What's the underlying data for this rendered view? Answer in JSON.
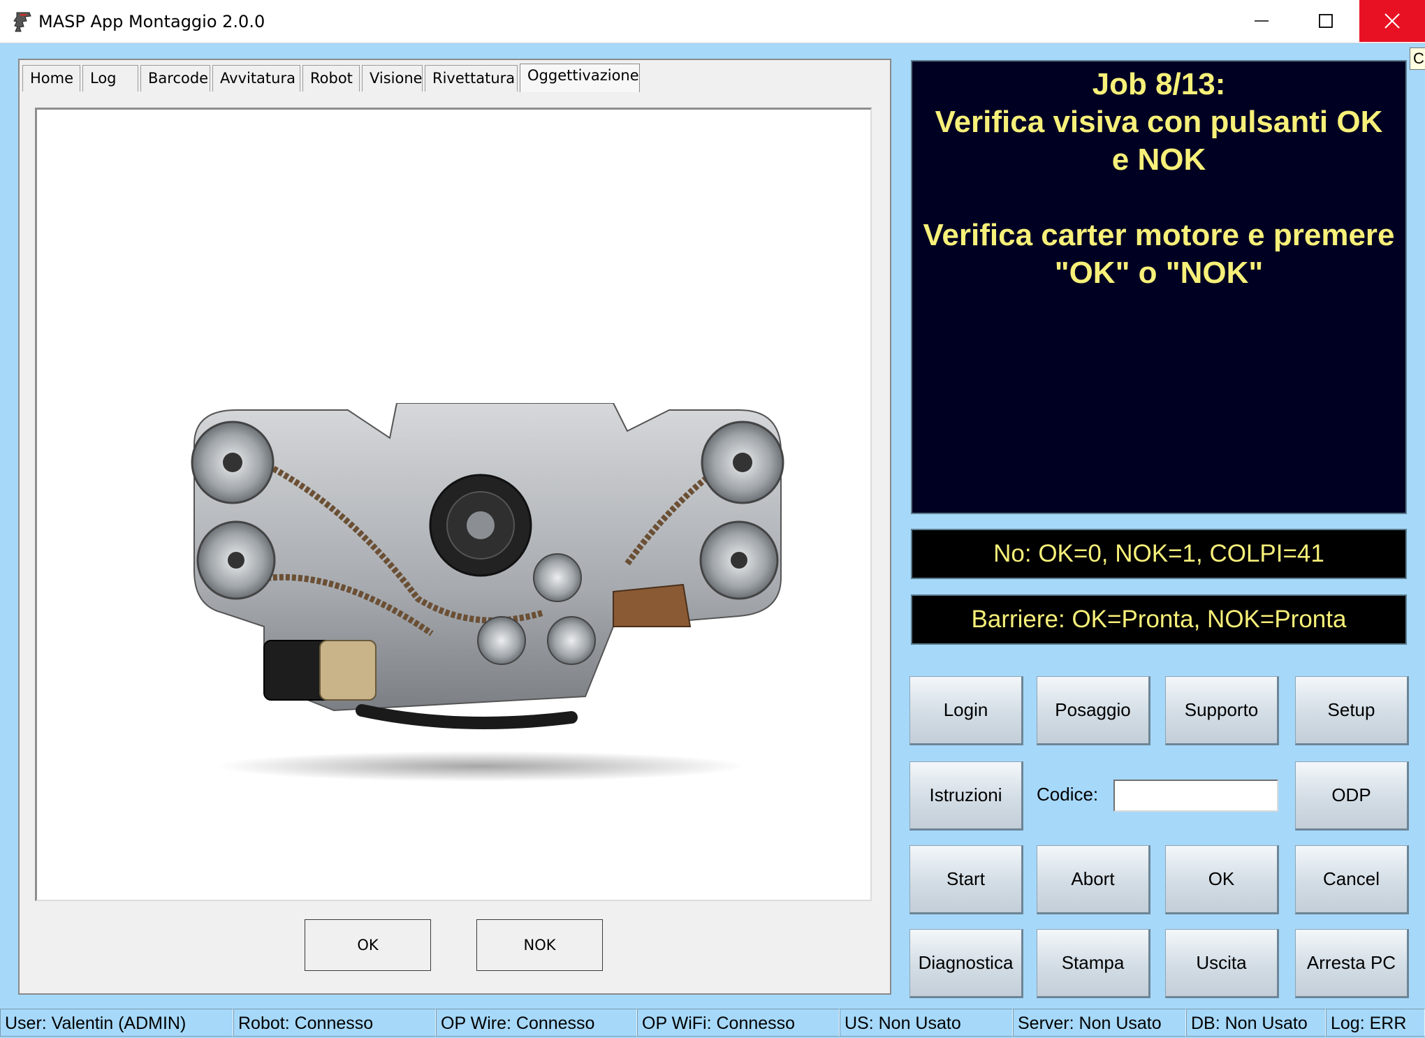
{
  "window": {
    "title": "MASP App Montaggio 2.0.0"
  },
  "tabs": [
    "Home",
    "Log",
    "Barcode",
    "Avvitatura",
    "Robot",
    "Visione",
    "Rivettatura",
    "Oggettivazione"
  ],
  "active_tab": "Oggettivazione",
  "panel": {
    "ok_label": "OK",
    "nok_label": "NOK"
  },
  "message": {
    "line1": "Job 8/13:",
    "line2": "Verifica visiva con pulsanti OK",
    "line3": "e NOK",
    "line4": "Verifica carter motore e premere",
    "line5": "\"OK\" o \"NOK\""
  },
  "counter": "No: OK=0, NOK=1, COLPI=41",
  "barrier": "Barriere: OK=Pronta, NOK=Pronta",
  "buttons": {
    "login": "Login",
    "posaggio": "Posaggio",
    "supporto": "Supporto",
    "setup": "Setup",
    "istruzioni": "Istruzioni",
    "odp": "ODP",
    "start": "Start",
    "abort": "Abort",
    "ok": "OK",
    "cancel": "Cancel",
    "diagnostica": "Diagnostica",
    "stampa": "Stampa",
    "uscita": "Uscita",
    "arresta": "Arresta PC"
  },
  "codice": {
    "label": "Codice:",
    "value": ""
  },
  "tooltip": "Cl",
  "status_bar": {
    "user": "User: Valentin (ADMIN)",
    "robot": "Robot: Connesso",
    "op_wire": "OP Wire: Connesso",
    "op_wifi": "OP WiFi: Connesso",
    "us": "US: Non Usato",
    "server": "Server: Non Usato",
    "db": "DB: Non Usato",
    "log": "Log: ERR"
  },
  "colors": {
    "background": "#a6d8f9",
    "message_bg": "#000022",
    "message_text": "#f7f079",
    "close_button": "#e81123"
  }
}
